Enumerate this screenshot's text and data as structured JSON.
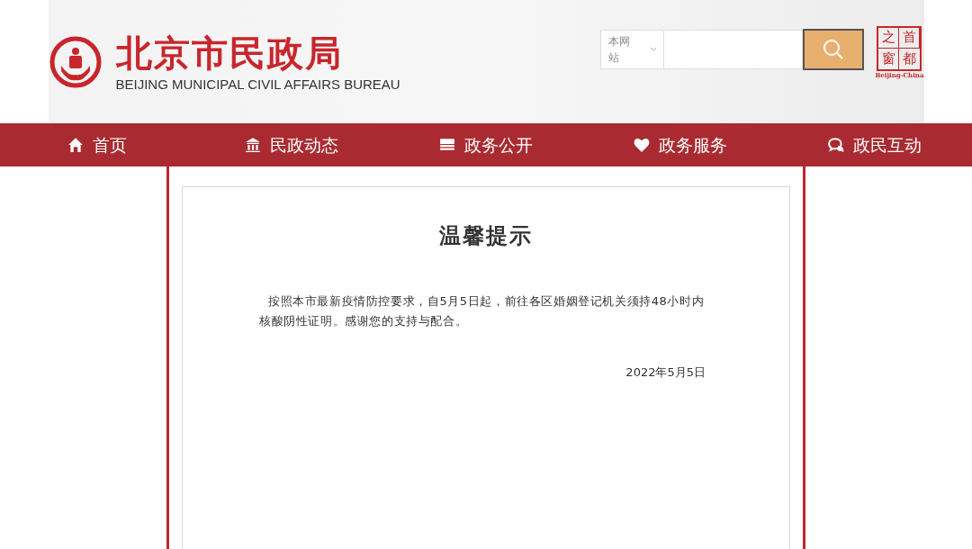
{
  "header": {
    "title": "北京市民政局",
    "subtitle": "BEIJING MUNICIPAL CIVIL AFFAIRS BUREAU",
    "search": {
      "scope": "本网站"
    },
    "seal": {
      "chars": [
        "之",
        "首",
        "窗",
        "都"
      ],
      "caption": "Beijing-China"
    }
  },
  "nav": [
    {
      "label": "首页",
      "kind": "home"
    },
    {
      "label": "民政动态",
      "kind": "building"
    },
    {
      "label": "政务公开",
      "kind": "book"
    },
    {
      "label": "政务服务",
      "kind": "heart"
    },
    {
      "label": "政民互动",
      "kind": "chat"
    }
  ],
  "notice": {
    "title": "温馨提示",
    "body": "按照本市最新疫情防控要求，自5月5日起，前往各区婚姻登记机关须持48小时内核酸阴性证明。感谢您的支持与配合。",
    "date": "2022年5月5日"
  }
}
